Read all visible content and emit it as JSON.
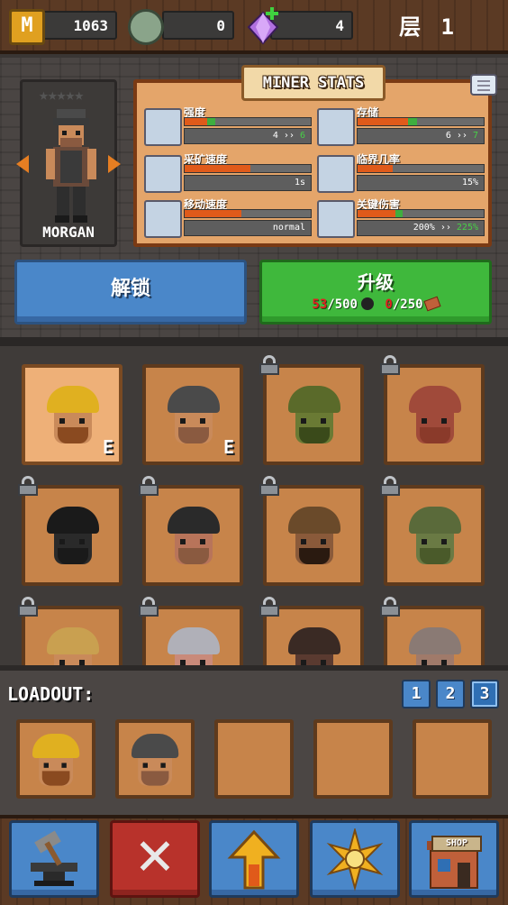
{
  "resources": {
    "gold": "1063",
    "stone_gems": "0",
    "crystals": "4"
  },
  "floor": {
    "label": "层",
    "number": "1"
  },
  "miner": {
    "name": "MORGAN",
    "stars": "★★★★★",
    "stars_filled": 0
  },
  "stats_panel": {
    "title": "MINER STATS",
    "stats": [
      {
        "label": "强度",
        "current": "4",
        "next": "6",
        "fill": 0.18,
        "add": 0.06,
        "color": "#e05a1a",
        "icon": "arm-icon"
      },
      {
        "label": "存储",
        "current": "6",
        "next": "7",
        "fill": 0.4,
        "add": 0.07,
        "color": "#e05a1a",
        "icon": "backpack-icon"
      },
      {
        "label": "采矿速度",
        "value": "1s",
        "fill": 0.52,
        "color": "#e05a1a",
        "icon": "pickaxe-icon"
      },
      {
        "label": "临界几率",
        "value": "15%",
        "fill": 0.28,
        "color": "#e05a1a",
        "icon": "sparkle-icon"
      },
      {
        "label": "移动速度",
        "value": "normal",
        "fill": 0.45,
        "color": "#e05a1a",
        "icon": "boot-icon"
      },
      {
        "label": "关键伤害",
        "current": "200%",
        "next": "225%",
        "fill": 0.3,
        "add": 0.06,
        "color": "#e05a1a",
        "icon": "crit-pickaxe-icon"
      }
    ]
  },
  "buttons": {
    "unlock_label": "解锁",
    "upgrade_label": "升级",
    "cost_coal_have": "53",
    "cost_coal_need": "/500",
    "cost_brick_have": "0",
    "cost_brick_need": "/250"
  },
  "roster": [
    {
      "name": "gold-helmet-miner",
      "locked": false,
      "equipped": true,
      "selected": true,
      "hat": "#e0b020",
      "face": "#c98a5a",
      "beard": "#8a4a20"
    },
    {
      "name": "morgan-miner",
      "locked": false,
      "equipped": true,
      "selected": false,
      "hat": "#4a4a4a",
      "face": "#c98a5a",
      "beard": "#8a5a40"
    },
    {
      "name": "goblin-miner",
      "locked": true,
      "equipped": false,
      "selected": false,
      "hat": "#5a6a2a",
      "face": "#6a7a34",
      "beard": "#3a4a1a"
    },
    {
      "name": "bald-miner",
      "locked": true,
      "equipped": false,
      "selected": false,
      "hat": "#a04a3a",
      "face": "#a04a3a",
      "beard": "#8a3a2a"
    },
    {
      "name": "hooded-miner",
      "locked": true,
      "equipped": false,
      "selected": false,
      "hat": "#1a1a1a",
      "face": "#2a2a2a",
      "beard": "#1a1a1a"
    },
    {
      "name": "pirate-miner",
      "locked": true,
      "equipped": false,
      "selected": false,
      "hat": "#2a2a2a",
      "face": "#b8745a",
      "beard": "#8a5a40"
    },
    {
      "name": "bandana-miner",
      "locked": true,
      "equipped": false,
      "selected": false,
      "hat": "#6a4a2a",
      "face": "#8a5a3a",
      "beard": "#2a1a10"
    },
    {
      "name": "green-miner",
      "locked": true,
      "equipped": false,
      "selected": false,
      "hat": "#5a6a3a",
      "face": "#6a7a44",
      "beard": "#4a5a2a"
    },
    {
      "name": "blonde-miner",
      "locked": true,
      "equipped": false,
      "selected": false,
      "hat": "#c9a050",
      "face": "#c98a5a",
      "beard": "#8a5a30"
    },
    {
      "name": "cyborg-miner",
      "locked": true,
      "equipped": false,
      "selected": false,
      "hat": "#b0b0b8",
      "face": "#c98a7a",
      "beard": "#8a5a50"
    },
    {
      "name": "dark-miner",
      "locked": true,
      "equipped": false,
      "selected": false,
      "hat": "#3a2a24",
      "face": "#5a3a30",
      "beard": "#3a2a24"
    },
    {
      "name": "grey-miner",
      "locked": true,
      "equipped": false,
      "selected": false,
      "hat": "#8a7a74",
      "face": "#a07a6a",
      "beard": "#7a5a50"
    }
  ],
  "loadout": {
    "label": "LOADOUT:",
    "pages": [
      "1",
      "2",
      "3"
    ],
    "slots": [
      {
        "filled": true,
        "hat": "#e0b020",
        "face": "#c98a5a",
        "beard": "#8a4a20"
      },
      {
        "filled": true,
        "hat": "#4a4a4a",
        "face": "#c98a5a",
        "beard": "#8a5a40"
      },
      {
        "filled": false
      },
      {
        "filled": false
      },
      {
        "filled": false
      }
    ]
  },
  "equipped_marker": "E",
  "bottom_nav": {
    "shop_sign": "SHOP"
  }
}
